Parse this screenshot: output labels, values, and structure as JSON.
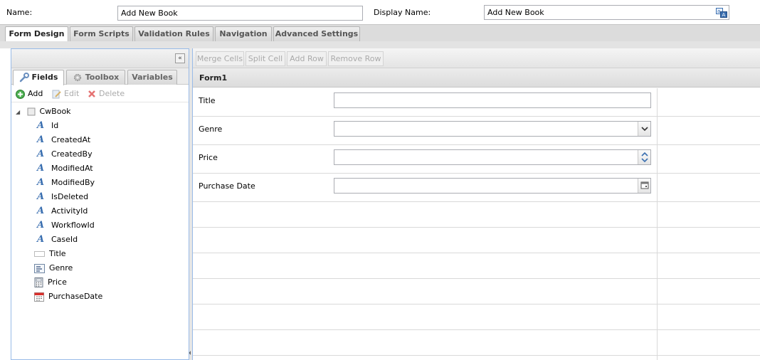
{
  "header": {
    "name_label": "Name:",
    "name_value": "Add New Book",
    "display_name_label": "Display Name:",
    "display_name_value": "Add New Book"
  },
  "main_tabs": [
    {
      "label": "Form Design",
      "active": true
    },
    {
      "label": "Form Scripts",
      "active": false
    },
    {
      "label": "Validation Rules",
      "active": false
    },
    {
      "label": "Navigation",
      "active": false
    },
    {
      "label": "Advanced Settings",
      "active": false
    }
  ],
  "left_panel": {
    "collapse_glyph": "«",
    "tabs": [
      {
        "label": "Fields",
        "icon": "wrench-icon",
        "active": true
      },
      {
        "label": "Toolbox",
        "icon": "gear-icon",
        "active": false
      },
      {
        "label": "Variables",
        "icon": "",
        "active": false
      }
    ],
    "toolbar": {
      "add": "Add",
      "edit": "Edit",
      "delete": "Delete"
    },
    "tree": {
      "root": "CwBook",
      "items": [
        {
          "label": "Id",
          "icon": "text-field-icon"
        },
        {
          "label": "CreatedAt",
          "icon": "text-field-icon"
        },
        {
          "label": "CreatedBy",
          "icon": "text-field-icon"
        },
        {
          "label": "ModifiedAt",
          "icon": "text-field-icon"
        },
        {
          "label": "ModifiedBy",
          "icon": "text-field-icon"
        },
        {
          "label": "IsDeleted",
          "icon": "text-field-icon"
        },
        {
          "label": "ActivityId",
          "icon": "text-field-icon"
        },
        {
          "label": "WorkflowId",
          "icon": "text-field-icon"
        },
        {
          "label": "CaseId",
          "icon": "text-field-icon"
        },
        {
          "label": "Title",
          "icon": "textbox-icon"
        },
        {
          "label": "Genre",
          "icon": "dropdown-icon"
        },
        {
          "label": "Price",
          "icon": "calculator-icon"
        },
        {
          "label": "PurchaseDate",
          "icon": "calendar-icon"
        }
      ]
    }
  },
  "right_panel": {
    "toolbar": {
      "merge": "Merge Cells",
      "split": "Split Cell",
      "add_row": "Add Row",
      "remove_row": "Remove Row"
    },
    "form_title": "Form1",
    "fields": [
      {
        "label": "Title",
        "control": "textbox"
      },
      {
        "label": "Genre",
        "control": "dropdown"
      },
      {
        "label": "Price",
        "control": "spinner"
      },
      {
        "label": "Purchase Date",
        "control": "datepicker"
      }
    ]
  }
}
